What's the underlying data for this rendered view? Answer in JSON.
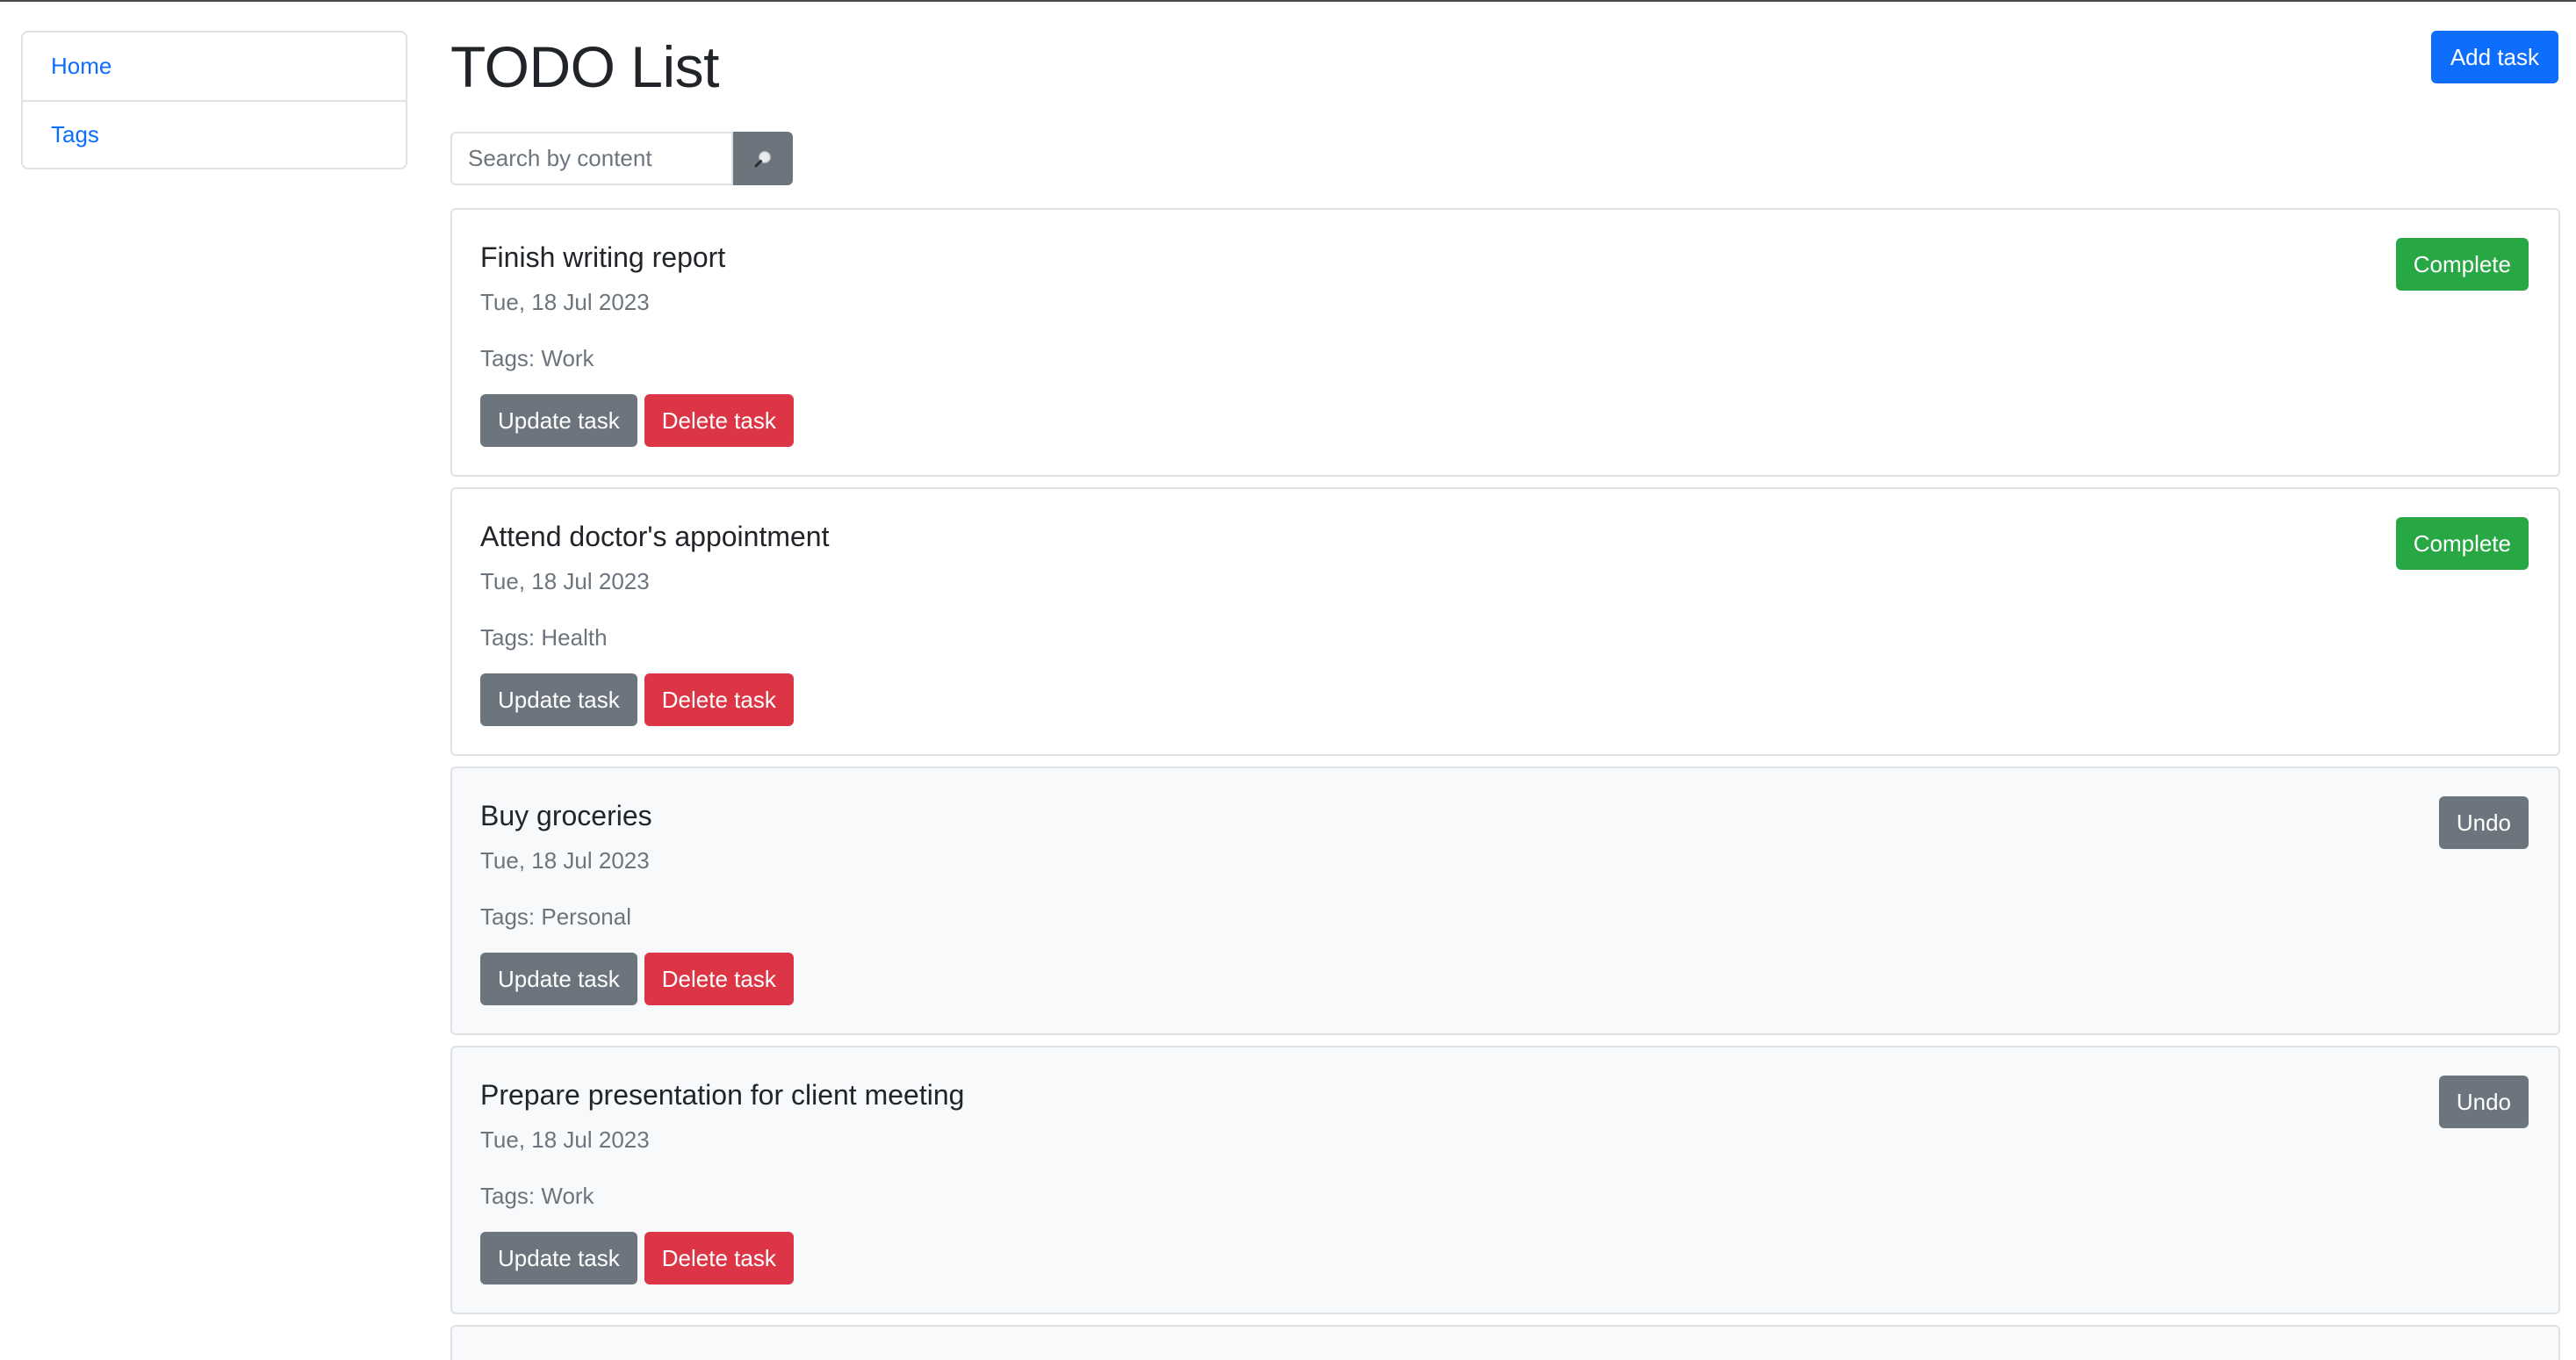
{
  "sidebar": {
    "items": [
      {
        "label": "Home"
      },
      {
        "label": "Tags"
      }
    ]
  },
  "header": {
    "title": "TODO List",
    "add_button_label": "Add task"
  },
  "search": {
    "placeholder": "Search by content",
    "value": "",
    "button_icon": "search-icon"
  },
  "tasks": [
    {
      "title": "Finish writing report",
      "date": "Tue, 18 Jul 2023",
      "tags": "Tags: Work",
      "status_label": "Complete",
      "completed": false,
      "update_label": "Update task",
      "delete_label": "Delete task"
    },
    {
      "title": "Attend doctor's appointment",
      "date": "Tue, 18 Jul 2023",
      "tags": "Tags: Health",
      "status_label": "Complete",
      "completed": false,
      "update_label": "Update task",
      "delete_label": "Delete task"
    },
    {
      "title": "Buy groceries",
      "date": "Tue, 18 Jul 2023",
      "tags": "Tags: Personal",
      "status_label": "Undo",
      "completed": true,
      "update_label": "Update task",
      "delete_label": "Delete task"
    },
    {
      "title": "Prepare presentation for client meeting",
      "date": "Tue, 18 Jul 2023",
      "tags": "Tags: Work",
      "status_label": "Undo",
      "completed": true,
      "update_label": "Update task",
      "delete_label": "Delete task"
    }
  ],
  "colors": {
    "primary": "#0d6efd",
    "secondary": "#6c757d",
    "danger": "#dc3545",
    "success": "#28a745",
    "completed_bg": "#f8f9fa"
  }
}
